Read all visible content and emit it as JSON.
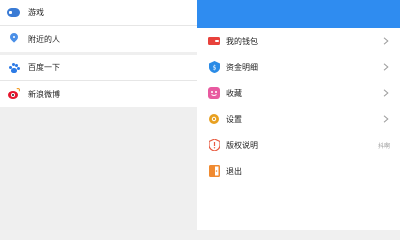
{
  "left": {
    "groups": [
      {
        "items": [
          {
            "label": "游戏",
            "icon": "gamepad-icon"
          },
          {
            "label": "附近的人",
            "icon": "location-pin-icon"
          }
        ]
      },
      {
        "items": [
          {
            "label": "百度一下",
            "icon": "baidu-paw-icon"
          },
          {
            "label": "新浪微博",
            "icon": "weibo-icon"
          }
        ]
      }
    ]
  },
  "right": {
    "header_color": "#2f8cf0",
    "menu": [
      {
        "label": "我的钱包",
        "icon": "wallet-icon",
        "color": "#e8423c",
        "chevron": true,
        "extra": ""
      },
      {
        "label": "资金明细",
        "icon": "funds-detail-icon",
        "color": "#2a8be6",
        "chevron": true,
        "extra": ""
      },
      {
        "label": "收藏",
        "icon": "favorite-icon",
        "color": "#e85aa0",
        "chevron": true,
        "extra": ""
      },
      {
        "label": "设置",
        "icon": "settings-gear-icon",
        "color": "#e8a020",
        "chevron": true,
        "extra": ""
      },
      {
        "label": "版权说明",
        "icon": "copyright-shield-icon",
        "color": "#e85a40",
        "chevron": false,
        "extra": "抖啊"
      },
      {
        "label": "退出",
        "icon": "logout-icon",
        "color": "#f08a30",
        "chevron": false,
        "extra": ""
      }
    ]
  }
}
